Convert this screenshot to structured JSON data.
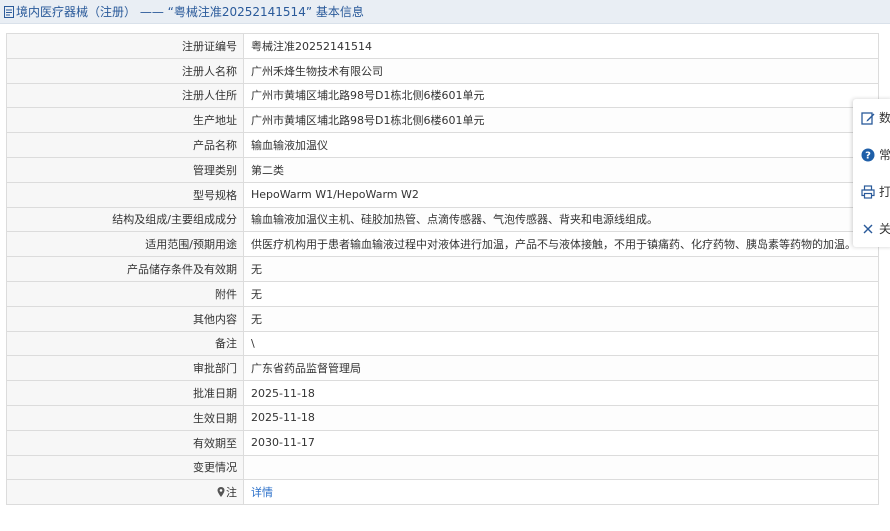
{
  "header": {
    "title": "境内医疗器械（注册） —— “粤械注准20252141514” 基本信息"
  },
  "rows": [
    {
      "label": "注册证编号",
      "value": "粤械注准20252141514"
    },
    {
      "label": "注册人名称",
      "value": "广州禾烽生物技术有限公司"
    },
    {
      "label": "注册人住所",
      "value": "广州市黄埔区埔北路98号D1栋北侧6楼601单元"
    },
    {
      "label": "生产地址",
      "value": "广州市黄埔区埔北路98号D1栋北侧6楼601单元"
    },
    {
      "label": "产品名称",
      "value": "输血输液加温仪"
    },
    {
      "label": "管理类别",
      "value": "第二类"
    },
    {
      "label": "型号规格",
      "value": "HepoWarm W1/HepoWarm W2"
    },
    {
      "label": "结构及组成/主要组成成分",
      "value": "输血输液加温仪主机、硅胶加热管、点滴传感器、气泡传感器、背夹和电源线组成。"
    },
    {
      "label": "适用范围/预期用途",
      "value": "供医疗机构用于患者输血输液过程中对液体进行加温，产品不与液体接触，不用于镇痛药、化疗药物、胰岛素等药物的加温。"
    },
    {
      "label": "产品储存条件及有效期",
      "value": "无"
    },
    {
      "label": "附件",
      "value": "无"
    },
    {
      "label": "其他内容",
      "value": "无"
    },
    {
      "label": "备注",
      "value": "\\"
    },
    {
      "label": "审批部门",
      "value": "广东省药品监督管理局"
    },
    {
      "label": "批准日期",
      "value": "2025-11-18"
    },
    {
      "label": "生效日期",
      "value": "2025-11-18"
    },
    {
      "label": "有效期至",
      "value": "2030-11-17"
    },
    {
      "label": "变更情况",
      "value": ""
    }
  ],
  "note_row": {
    "label": "注",
    "link": "详情"
  },
  "side_toolbar": [
    {
      "icon": "edit-icon",
      "label": "数"
    },
    {
      "icon": "question-icon",
      "label": "常"
    },
    {
      "icon": "printer-icon",
      "label": "打"
    },
    {
      "icon": "close-icon",
      "label": "关"
    }
  ],
  "colors": {
    "header_bg": "#e9eef4",
    "header_text": "#2a5a9a",
    "link": "#2a6fc9",
    "border": "#dcdcdc",
    "label_bg": "#f7f7f7"
  }
}
